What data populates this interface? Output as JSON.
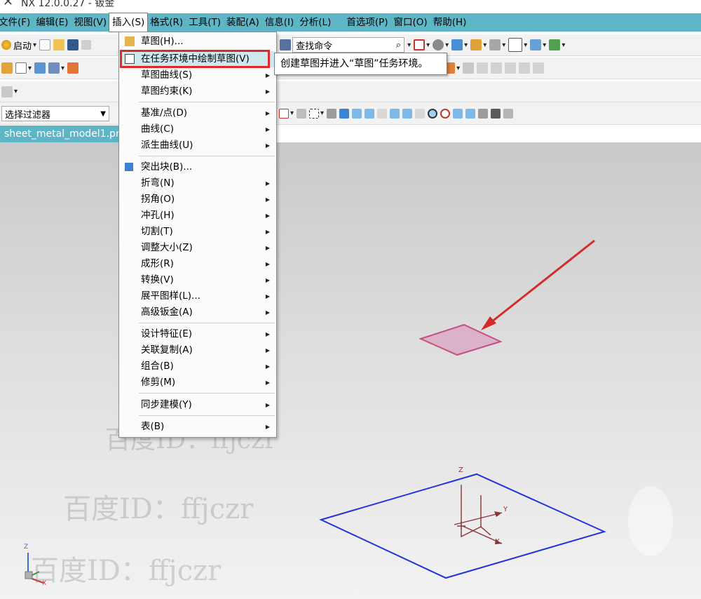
{
  "window": {
    "title": "NX 12.0.0.27 - 钣金"
  },
  "menubar": [
    "文件(F)",
    "编辑(E)",
    "视图(V)",
    "插入(S)",
    "格式(R)",
    "工具(T)",
    "装配(A)",
    "信息(I)",
    "分析(L)",
    "首选项(P)",
    "窗口(O)",
    "帮助(H)"
  ],
  "toolbar": {
    "start_label": "启动",
    "search_value": "查找命令"
  },
  "filter": {
    "label": "选择过滤器"
  },
  "document_tab": {
    "label": "sheet_metal_model1.prt"
  },
  "insert_menu": {
    "items": [
      {
        "label": "草图(H)..."
      },
      {
        "label": "在任务环境中绘制草图(V)"
      },
      {
        "label": "草图曲线(S)"
      },
      {
        "label": "草图约束(K)"
      },
      {
        "label": "基准/点(D)"
      },
      {
        "label": "曲线(C)"
      },
      {
        "label": "派生曲线(U)"
      },
      {
        "label": "突出块(B)..."
      },
      {
        "label": "折弯(N)"
      },
      {
        "label": "拐角(O)"
      },
      {
        "label": "冲孔(H)"
      },
      {
        "label": "切割(T)"
      },
      {
        "label": "调整大小(Z)"
      },
      {
        "label": "成形(R)"
      },
      {
        "label": "转换(V)"
      },
      {
        "label": "展平图样(L)..."
      },
      {
        "label": "高级钣金(A)"
      },
      {
        "label": "设计特征(E)"
      },
      {
        "label": "关联复制(A)"
      },
      {
        "label": "组合(B)"
      },
      {
        "label": "修剪(M)"
      },
      {
        "label": "同步建模(Y)"
      },
      {
        "label": "表(B)"
      }
    ]
  },
  "tooltip": {
    "text": "创建草图并进入“草图”任务环境。"
  },
  "viewport": {
    "axes": {
      "x": "X",
      "y": "Y",
      "z": "Z"
    },
    "watermark": "百度ID：ffjczr"
  },
  "colors": {
    "menubar": "#5db5c6",
    "highlight_box": "#e02828",
    "arrow": "#d42a2a",
    "datum_plane": "#2233dd",
    "sketch_plane": "#c64f86"
  }
}
